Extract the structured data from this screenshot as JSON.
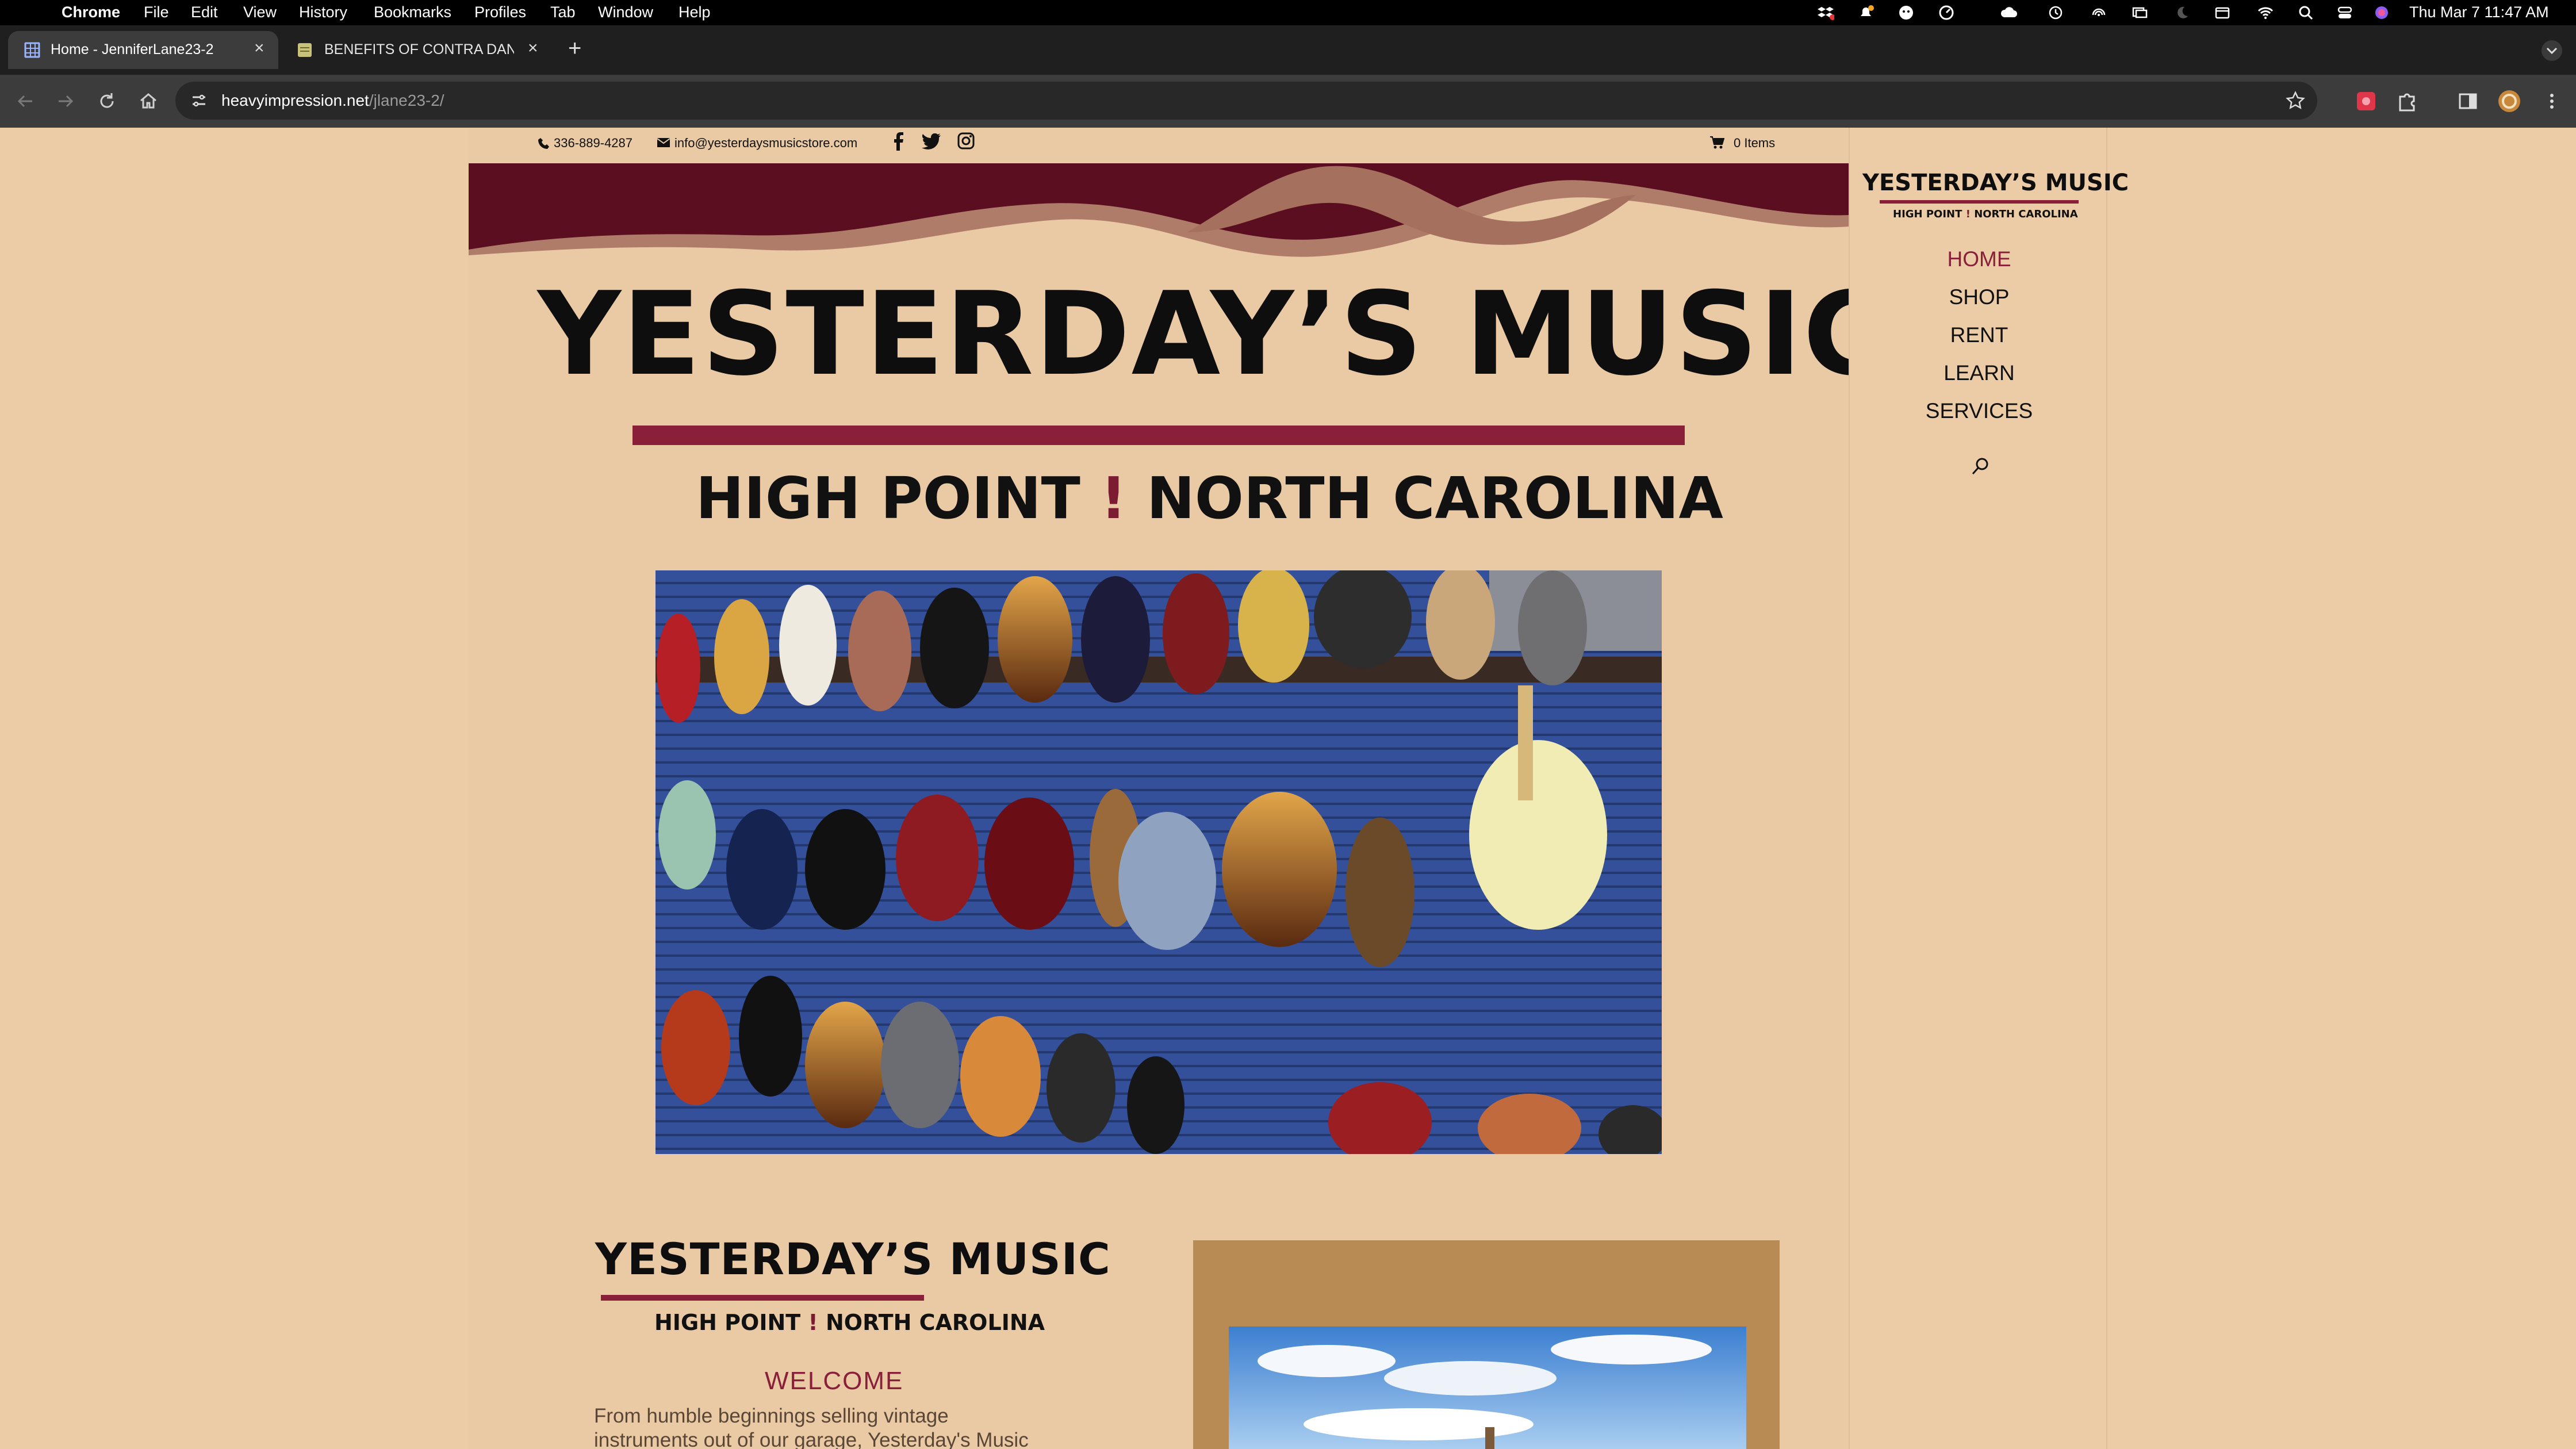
{
  "menubar": {
    "app": "Chrome",
    "items": [
      "File",
      "Edit",
      "View",
      "History",
      "Bookmarks",
      "Profiles",
      "Tab",
      "Window",
      "Help"
    ],
    "clock": "Thu Mar 7  11:47 AM"
  },
  "tabs": [
    {
      "title": "Home - JenniferLane23-2",
      "active": true
    },
    {
      "title": "BENEFITS OF CONTRA DANC",
      "active": false
    }
  ],
  "address": {
    "host": "heavyimpression.net",
    "path": "/jlane23-2/"
  },
  "topbar": {
    "phone": "336-889-4287",
    "email": "info@yesterdaysmusicstore.com",
    "cart": "0 Items"
  },
  "hero": {
    "title": "YESTERDAY’S MUSIC",
    "subtitle_left": "HIGH POINT",
    "bang": "!",
    "subtitle_right": "NORTH CAROLINA",
    "image_alt": "Wall of electric guitars"
  },
  "sidebar": {
    "logo_title": "YESTERDAY’S MUSIC",
    "logo_sub_left": "HIGH POINT",
    "logo_sub_right": "NORTH CAROLINA",
    "nav": [
      "HOME",
      "SHOP",
      "RENT",
      "LEARN",
      "SERVICES"
    ],
    "active_index": 0
  },
  "welcome": {
    "title": "YESTERDAY’S MUSIC",
    "sub_left": "HIGH POINT",
    "sub_right": "NORTH CAROLINA",
    "heading": "WELCOME",
    "line1": " From humble beginnings selling vintage",
    "line2": "instruments out of our garage, Yesterday's Music"
  },
  "colors": {
    "page_bg": "#ebcca6",
    "maroon": "#5a0e1f",
    "accent": "#8a1f3a",
    "gold_panel": "#b98b54"
  }
}
